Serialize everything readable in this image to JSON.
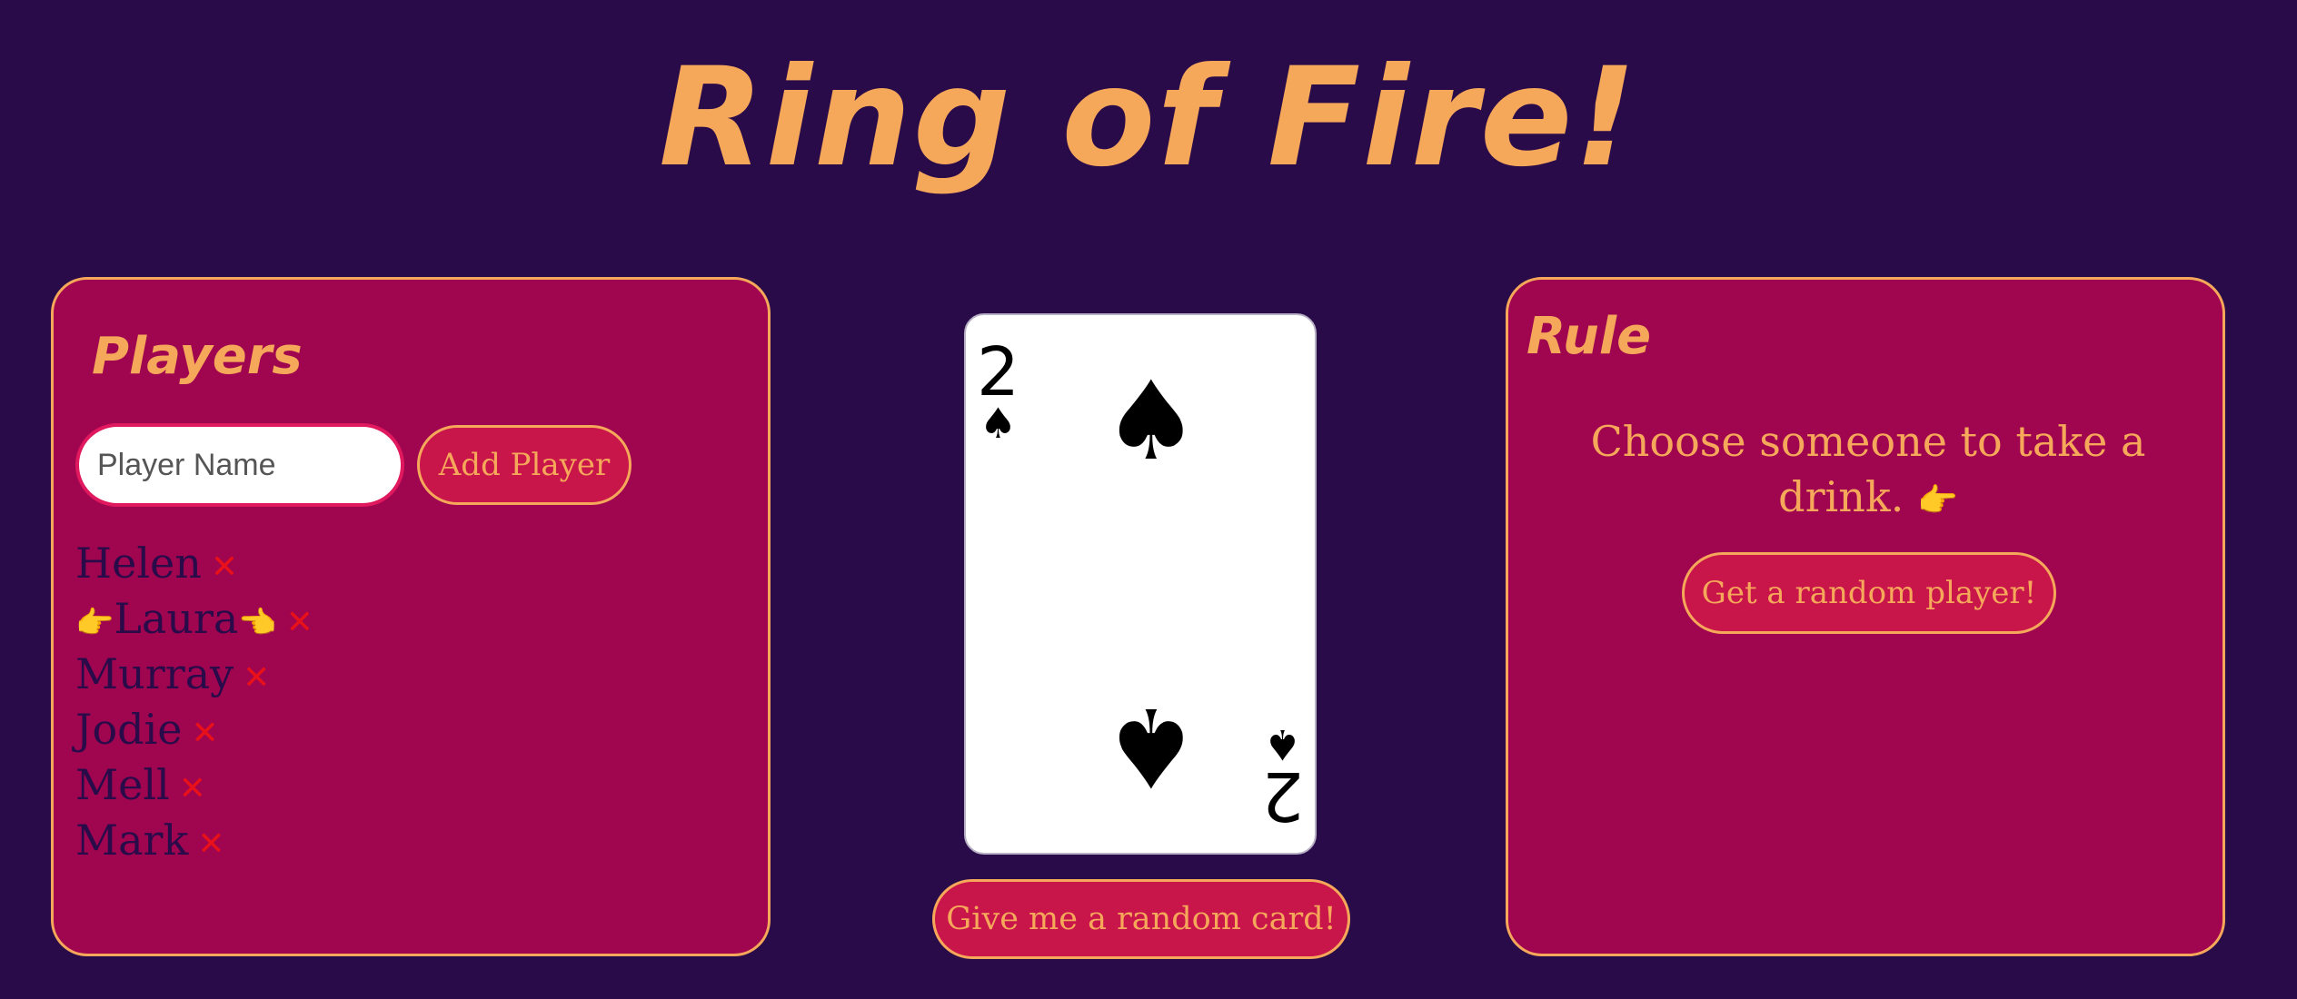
{
  "app": {
    "title": "Ring of Fire!"
  },
  "players_panel": {
    "heading": "Players",
    "input_placeholder": "Player Name",
    "add_button_label": "Add Player",
    "remove_glyph": "✕",
    "players": [
      {
        "name": "Helen",
        "current": false
      },
      {
        "name": "Laura",
        "current": true
      },
      {
        "name": "Murray",
        "current": false
      },
      {
        "name": "Jodie",
        "current": false
      },
      {
        "name": "Mell",
        "current": false
      },
      {
        "name": "Mark",
        "current": false
      }
    ]
  },
  "card": {
    "rank": "2",
    "suit": "♠",
    "suit_name": "spades",
    "button_label": "Give me a random card!"
  },
  "rule_panel": {
    "heading": "Rule",
    "text": "Choose someone to take a drink.",
    "text_icon": "pointing-finger-icon",
    "button_label": "Get a random player!"
  },
  "colors": {
    "background": "#2a0b4a",
    "accent": "#f6a85a",
    "panel": "#a0054f",
    "button": "#c8154a",
    "remove": "#e8101a"
  }
}
